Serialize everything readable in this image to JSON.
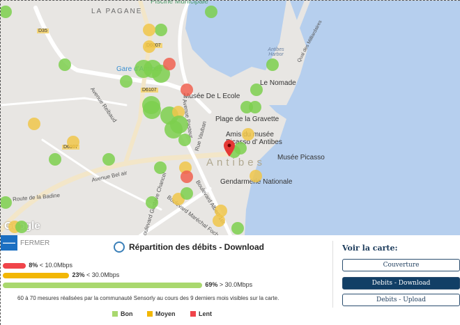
{
  "map": {
    "labels": {
      "pagane": "LA PAGANE",
      "piscine": "Piscine Municipale",
      "d35": "D35",
      "d6007": "D6007",
      "gare": "Gare d'Antibes",
      "d6107a": "D6107",
      "d6107b": "D6107",
      "reibaud": "Avenue Reibaud",
      "musee_ecole": "Musée De L Ecole",
      "plage": "Plage de la Gravette",
      "amis": "Amis du musée",
      "amis2": "Picasso d' Antibes",
      "antibes": "Antibes",
      "musee_picasso": "Musée Picasso",
      "gendarmerie": "Gendarmerie Nationale",
      "nomade": "Le Nomade",
      "harbor": "Antibes Harbor",
      "quai": "Quai des Milliardaires",
      "belair": "Avenue Bel air",
      "badine": "Route de la Badine",
      "chancel": "Boulevard Gustave Chancel",
      "albert": "Boulevard Albert 1er",
      "marechal": "Boulevard Maréchal Foch",
      "vauban": "Rue Vauban",
      "pasteur": "Avenue Pasteur",
      "google": "Google"
    },
    "colors": {
      "bon": "#7ccf4e",
      "moyen": "#f0c54a",
      "lent": "#f06050"
    }
  },
  "panel": {
    "close_icon": "minus-icon",
    "close_label": "FERMER",
    "title": "Répartition des débits - Download",
    "title_icon": "speedometer-icon",
    "bars": [
      {
        "pct": "8%",
        "label": "< 10.0Mbps",
        "value": 8,
        "color": "#f0444a"
      },
      {
        "pct": "23%",
        "label": "< 30.0Mbps",
        "value": 23,
        "color": "#f2b705"
      },
      {
        "pct": "69%",
        "label": "> 30.0Mbps",
        "value": 69,
        "color": "#a9d86e"
      }
    ],
    "note": "60 à 70 mesures réalisées par la communauté Sensorly au cours des 9 derniers mois visibles sur la carte.",
    "legend": [
      {
        "label": "Bon",
        "color": "#a9d86e"
      },
      {
        "label": "Moyen",
        "color": "#f2b705"
      },
      {
        "label": "Lent",
        "color": "#f0444a"
      }
    ]
  },
  "sidebar": {
    "heading": "Voir la carte:",
    "buttons": [
      {
        "label": "Couverture"
      },
      {
        "label": "Debits - Download",
        "active": true
      },
      {
        "label": "Debits - Upload"
      }
    ]
  }
}
